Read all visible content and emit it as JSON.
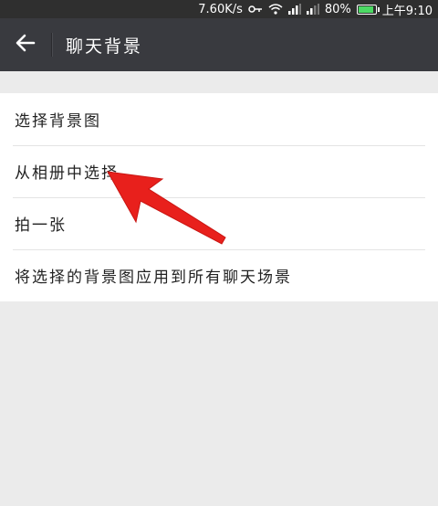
{
  "status_bar": {
    "speed": "7.60K/s",
    "battery_percent": "80%",
    "battery_level": 0.8,
    "time": "上午9:10",
    "icons": [
      "key-icon",
      "wifi-icon",
      "signal-icon",
      "signal-icon",
      "battery-icon"
    ]
  },
  "header": {
    "back_icon": "arrow-left-icon",
    "title": "聊天背景"
  },
  "menu": {
    "items": [
      {
        "label": "选择背景图"
      },
      {
        "label": "从相册中选择"
      },
      {
        "label": "拍一张"
      },
      {
        "label": "将选择的背景图应用到所有聊天场景"
      }
    ]
  },
  "annotation": {
    "arrow_color": "#e8201c"
  },
  "colors": {
    "title_bar": "#393a3f",
    "status_bar": "#2f2f2f",
    "background": "#ebebeb",
    "menu_bg": "#ffffff"
  }
}
